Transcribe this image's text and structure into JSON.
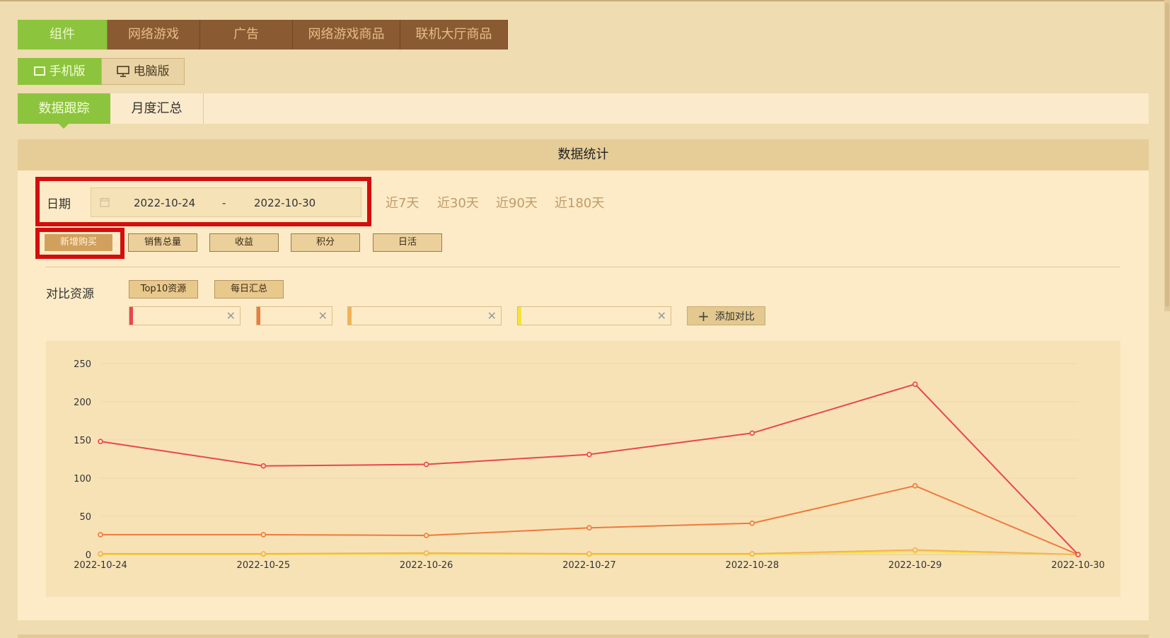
{
  "main_tabs": [
    {
      "label": "组件",
      "active": true
    },
    {
      "label": "网络游戏",
      "active": false
    },
    {
      "label": "广告",
      "active": false
    },
    {
      "label": "网络游戏商品",
      "active": false
    },
    {
      "label": "联机大厅商品",
      "active": false
    }
  ],
  "platform": {
    "mobile_label": "手机版",
    "pc_label": "电脑版",
    "mobile_icon": "mobile-icon",
    "pc_icon": "monitor-icon"
  },
  "subtabs": {
    "tracking_label": "数据跟踪",
    "monthly_label": "月度汇总"
  },
  "panel": {
    "title": "数据统计",
    "date_label": "日期",
    "date_start": "2022-10-24",
    "date_sep": "-",
    "date_end": "2022-10-30",
    "calendar_icon": "calendar-icon",
    "quick_ranges": [
      "近7天",
      "近30天",
      "近90天",
      "近180天"
    ],
    "metrics": [
      "新增购买",
      "销售总量",
      "收益",
      "积分",
      "日活"
    ],
    "active_metric": "新增购买",
    "compare_label": "对比资源",
    "top10_label": "Top10资源",
    "daily_label": "每日汇总",
    "resource_inputs": [
      {
        "value": "",
        "color": "#e8474e"
      },
      {
        "value": "",
        "color": "#ef7a3c"
      },
      {
        "value": "",
        "color": "#f2b258"
      },
      {
        "value": "",
        "color": "#f6e23c"
      }
    ],
    "add_compare_label": "添加对比"
  },
  "colors": {
    "accent_green": "#8cc43d",
    "tab_brown": "#8a5a33",
    "highlight_red": "#d40d0d"
  },
  "chart_data": {
    "type": "line",
    "x": [
      "2022-10-24",
      "2022-10-25",
      "2022-10-26",
      "2022-10-27",
      "2022-10-28",
      "2022-10-29",
      "2022-10-30"
    ],
    "ylim": [
      0,
      250
    ],
    "yticks": [
      0,
      50,
      100,
      150,
      200,
      250
    ],
    "grid": true,
    "series": [
      {
        "color": "#e8474e",
        "values": [
          148,
          116,
          118,
          131,
          159,
          223,
          0
        ]
      },
      {
        "color": "#ef7a3c",
        "values": [
          26,
          26,
          25,
          35,
          41,
          90,
          0
        ]
      },
      {
        "color": "#f2b258",
        "values": [
          1,
          1,
          2,
          1,
          1,
          6,
          0
        ]
      },
      {
        "color": "#f6e23c",
        "values": [
          0,
          0,
          1,
          0,
          0,
          4,
          0
        ]
      }
    ]
  }
}
